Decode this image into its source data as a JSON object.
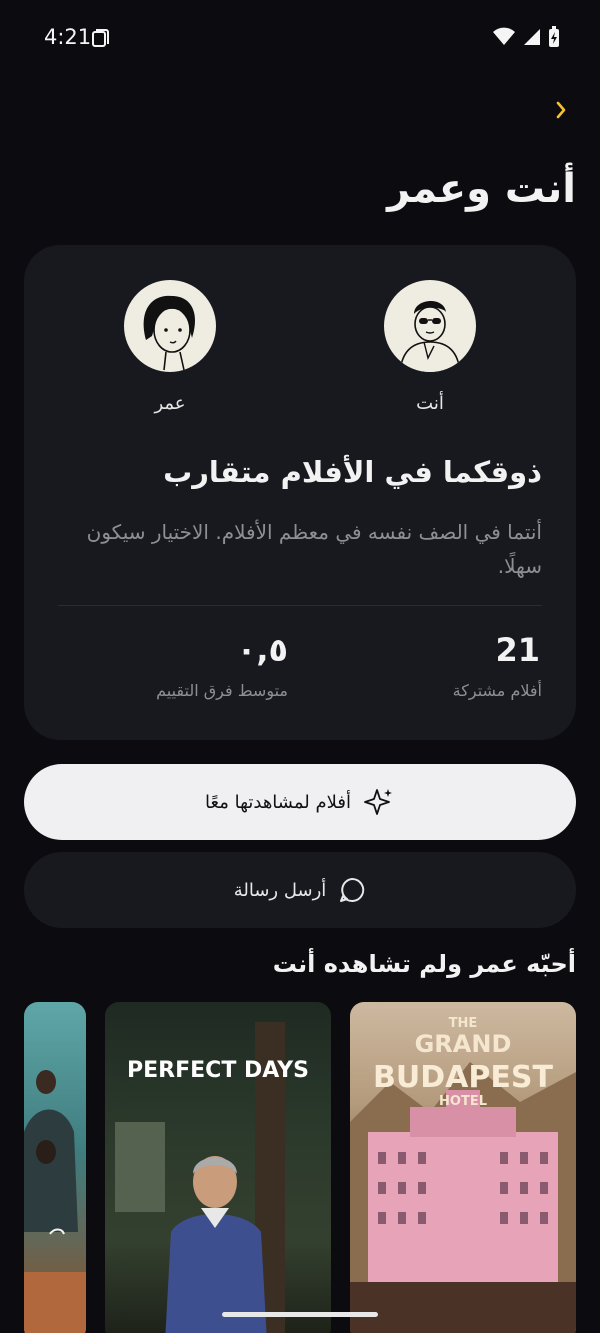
{
  "status_bar": {
    "time": "4:21"
  },
  "header": {
    "title": "أنت وعمر"
  },
  "compat_card": {
    "you_label": "أنت",
    "omar_label": "عمر",
    "verdict": "ذوقكما في الأفلام متقارب",
    "description": "أنتما في الصف نفسه في معظم الأفلام. الاختيار سيكون سهلًا.",
    "stats": {
      "shared_value": "21",
      "shared_label": "أفلام مشتركة",
      "diff_value": "٠,٥",
      "diff_label": "متوسط فرق التقييم"
    }
  },
  "actions": {
    "watch_together": "أفلام لمشاهدتها معًا",
    "send_message": "أرسل رسالة"
  },
  "section": {
    "title": "أحبّه عمر ولم تشاهده أنت"
  },
  "posters": [
    {
      "name": "grand-budapest",
      "line1": "THE",
      "line2": "GRAND",
      "line3": "BUDAPEST",
      "line4": "HOTEL"
    },
    {
      "name": "perfect-days",
      "title": "PERFECT DAYS"
    },
    {
      "name": "dune"
    }
  ],
  "colors": {
    "accent": "#f2c230",
    "background": "#0c0c10",
    "card": "#18181f"
  }
}
